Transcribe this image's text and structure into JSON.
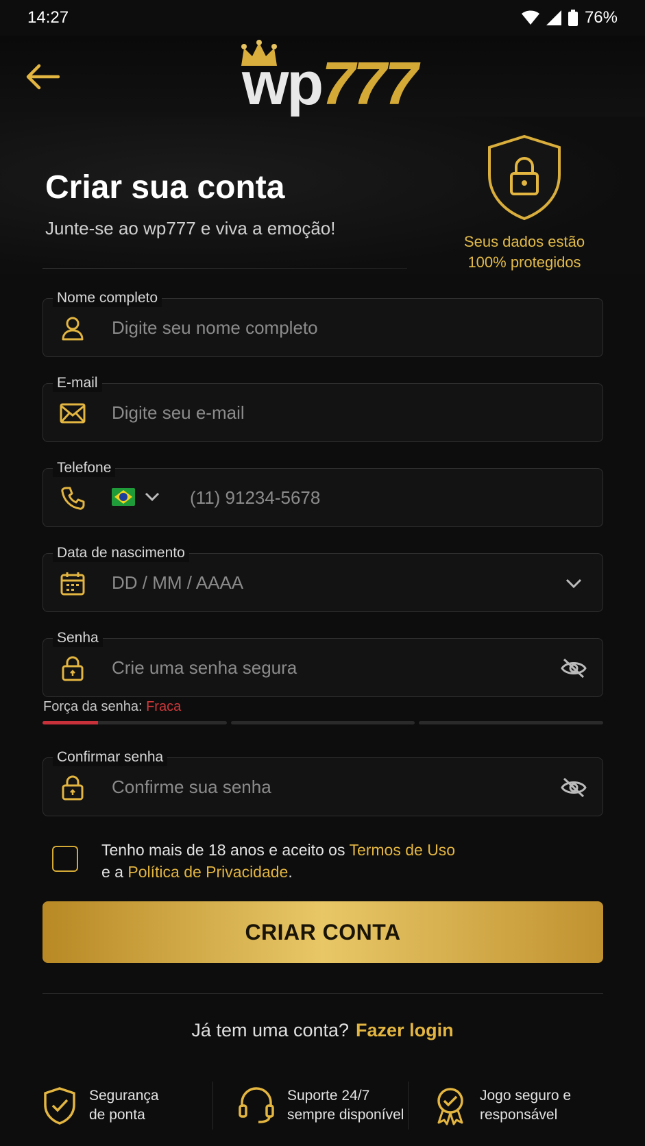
{
  "status_bar": {
    "time": "14:27",
    "battery": "76%"
  },
  "header": {
    "logo_wp": "wp",
    "logo_777": "777"
  },
  "hero": {
    "title": "Criar sua conta",
    "subtitle": "Junte-se ao wp777 e viva a emoção!",
    "security_line1": "Seus dados estão",
    "security_line2": "100% protegidos"
  },
  "form": {
    "name": {
      "label": "Nome completo",
      "placeholder": "Digite seu nome completo"
    },
    "email": {
      "label": "E-mail",
      "placeholder": "Digite seu e-mail"
    },
    "phone": {
      "label": "Telefone",
      "placeholder": "(11) 91234-5678"
    },
    "birthdate": {
      "label": "Data de nascimento",
      "placeholder": "DD / MM / AAAA"
    },
    "password": {
      "label": "Senha",
      "placeholder": "Crie uma senha segura"
    },
    "password_strength": {
      "label": "Força da senha: ",
      "value": "Fraca",
      "level": 0.1
    },
    "confirm": {
      "label": "Confirmar senha",
      "placeholder": "Confirme sua senha"
    }
  },
  "terms": {
    "prefix": "Tenho mais de 18 anos e aceito os ",
    "terms_link": "Termos de Uso",
    "middle": "e a ",
    "privacy_link": "Política de Privacidade",
    "suffix": "."
  },
  "cta": {
    "label": "CRIAR CONTA"
  },
  "login": {
    "prompt": "Já tem uma conta?",
    "link": "Fazer login"
  },
  "features": [
    {
      "icon": "shield-check-icon",
      "line1": "Segurança",
      "line2": "de ponta"
    },
    {
      "icon": "headset-icon",
      "line1": "Suporte 24/7",
      "line2": "sempre disponível"
    },
    {
      "icon": "award-badge-icon",
      "line1": "Jogo seguro e",
      "line2": "responsável"
    }
  ],
  "colors": {
    "accent": "#d4a936",
    "background": "#0d0d0d",
    "weak": "#d0393b"
  }
}
